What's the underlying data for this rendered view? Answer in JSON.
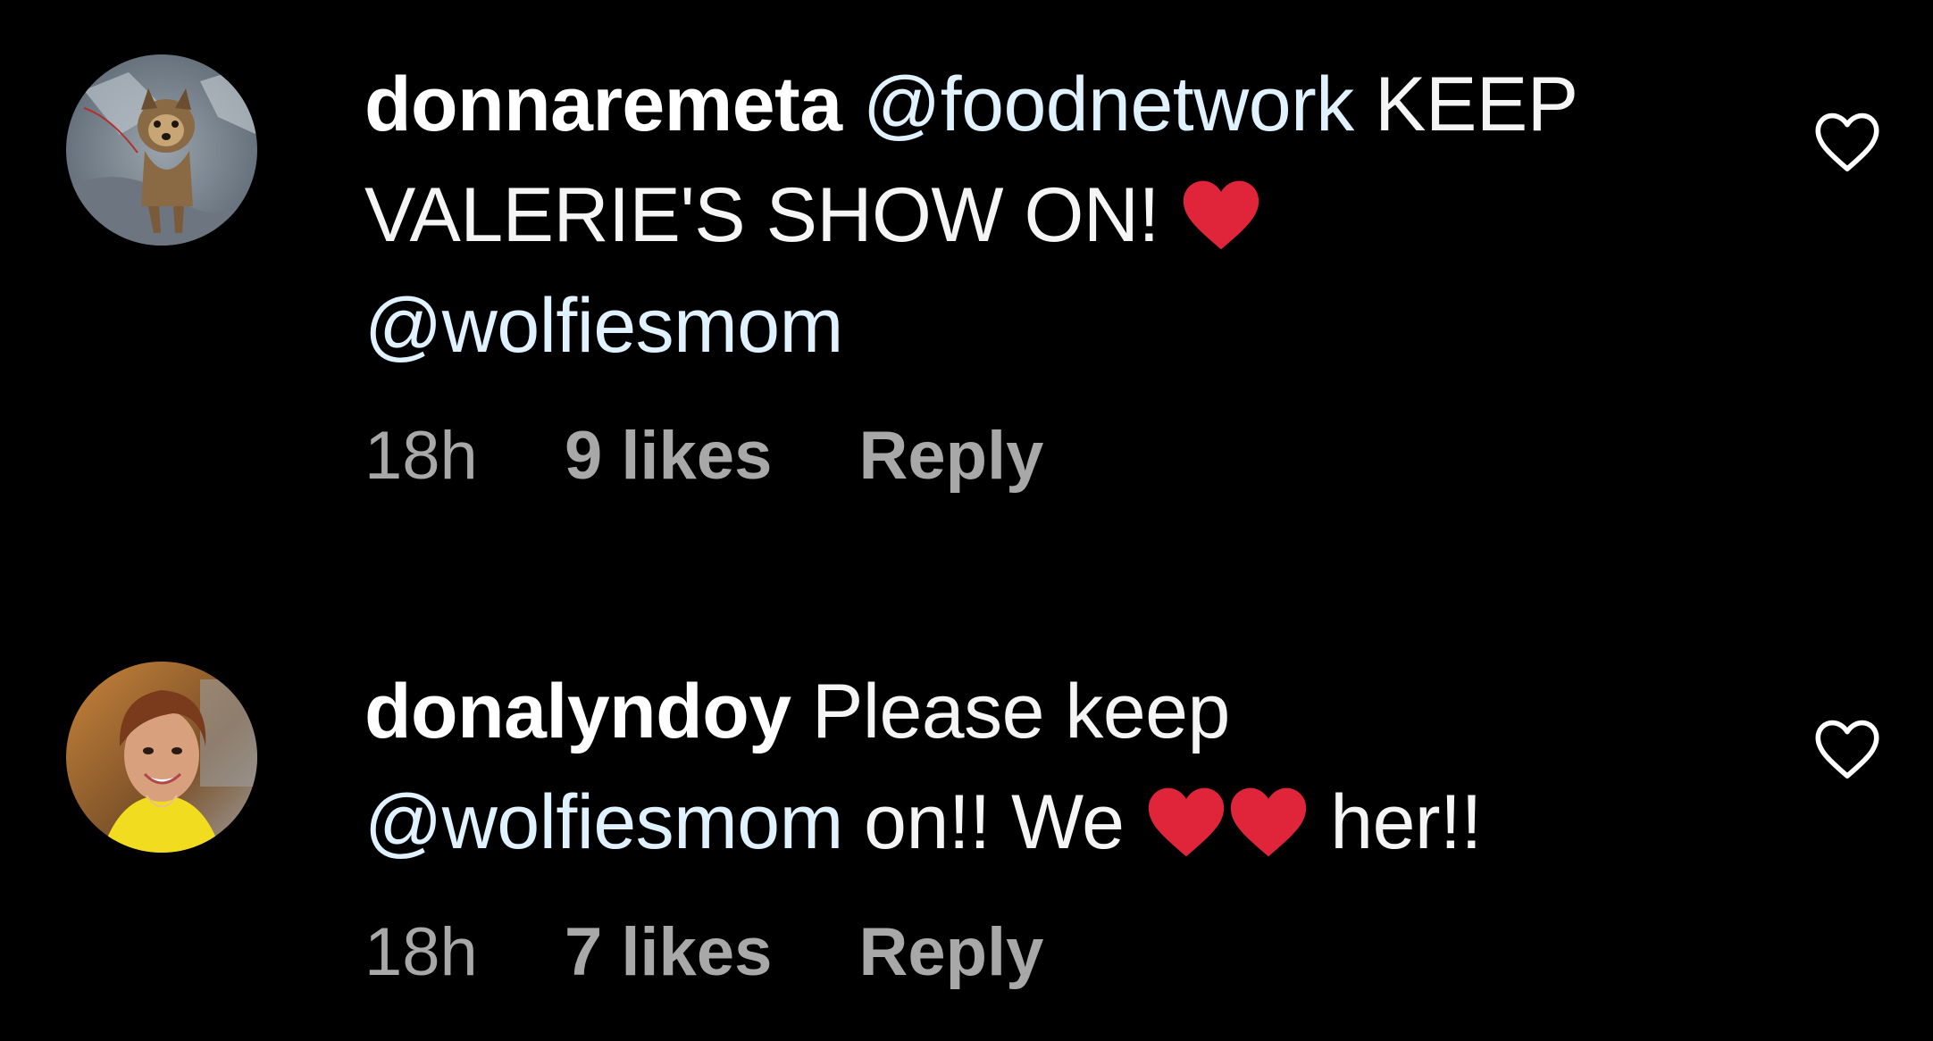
{
  "comments": [
    {
      "username": "donnaremeta",
      "text_parts": {
        "mention1": "@foodnetwork",
        "text1": " KEEP VALERIE'S SHOW ON! ",
        "mention2": "@wolfiesmom"
      },
      "time": "18h",
      "likes": "9 likes",
      "reply": "Reply",
      "avatar_icon": "dog-photo-avatar"
    },
    {
      "username": "donalyndoy",
      "text_parts": {
        "text1": " Please keep ",
        "mention1": "@wolfiesmom",
        "text2": " on!! We ",
        "text3": " her!!"
      },
      "time": "18h",
      "likes": "7 likes",
      "reply": "Reply",
      "avatar_icon": "woman-photo-avatar"
    }
  ],
  "icons": {
    "like": "heart-outline-icon",
    "emoji": "red-heart-emoji"
  },
  "colors": {
    "background": "#000000",
    "text": "#f5f5f5",
    "mention": "#e0f1ff",
    "meta": "#a8a8a8",
    "heart": "#e0243a"
  }
}
